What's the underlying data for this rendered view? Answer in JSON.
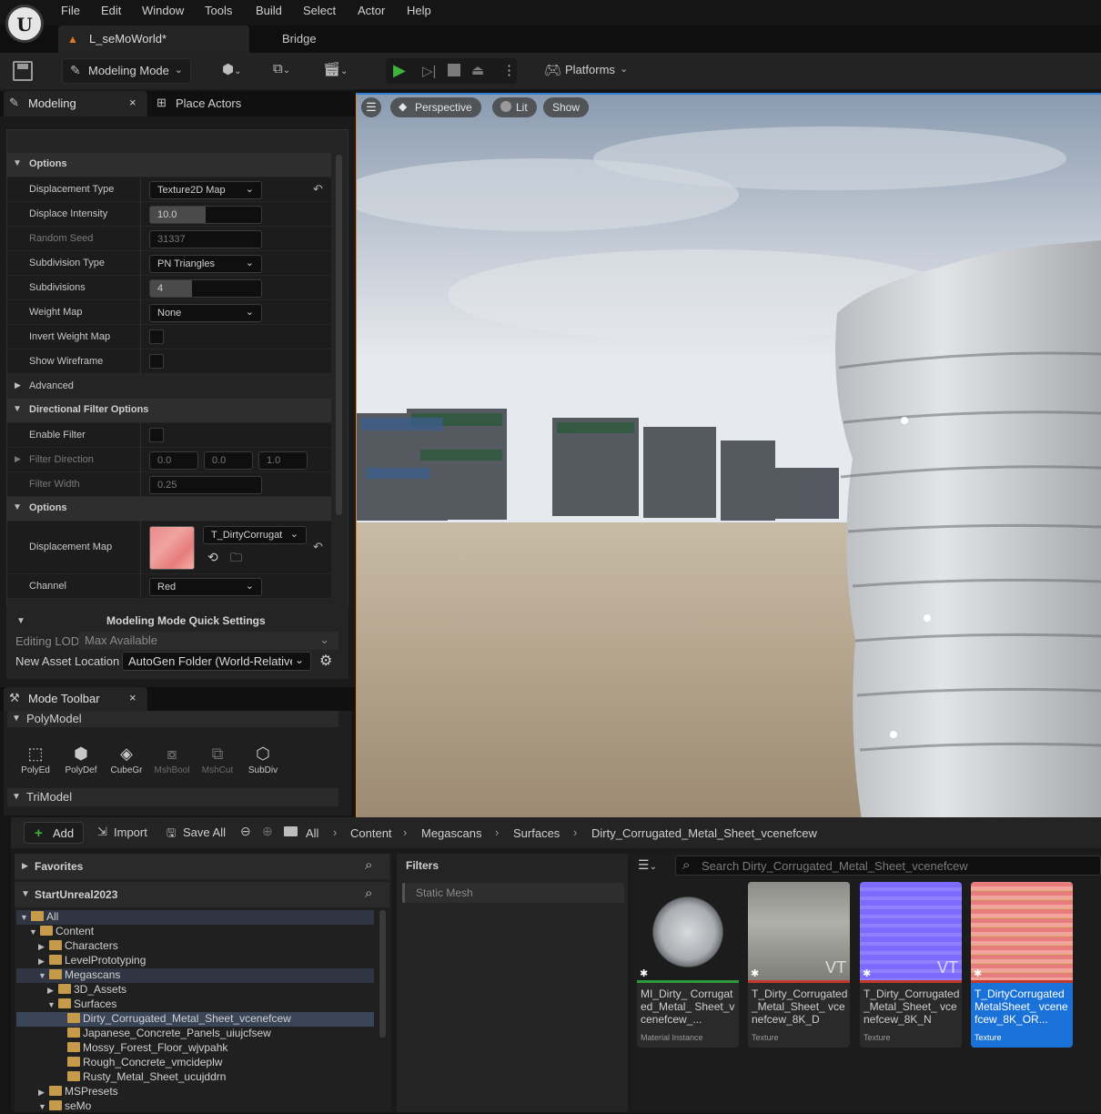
{
  "menu": [
    "File",
    "Edit",
    "Window",
    "Tools",
    "Build",
    "Select",
    "Actor",
    "Help"
  ],
  "doc_tab": "L_seMoWorld*",
  "bridge_tab": "Bridge",
  "toolbar": {
    "mode": "Modeling Mode",
    "platforms": "Platforms"
  },
  "panel_tabs": {
    "modeling": "Modeling",
    "place_actors": "Place Actors"
  },
  "details": {
    "options1": "Options",
    "displacement_type": {
      "label": "Displacement Type",
      "value": "Texture2D Map"
    },
    "displace_intensity": {
      "label": "Displace Intensity",
      "value": "10.0",
      "fill": 0.5
    },
    "random_seed": {
      "label": "Random Seed",
      "value": "31337"
    },
    "subdivision_type": {
      "label": "Subdivision Type",
      "value": "PN Triangles"
    },
    "subdivisions": {
      "label": "Subdivisions",
      "value": "4",
      "fill": 0.38
    },
    "weight_map": {
      "label": "Weight Map",
      "value": "None"
    },
    "invert_weight_map": "Invert Weight Map",
    "show_wireframe": "Show Wireframe",
    "advanced": "Advanced",
    "directional": "Directional Filter Options",
    "enable_filter": "Enable Filter",
    "filter_direction": {
      "label": "Filter Direction",
      "x": "0.0",
      "y": "0.0",
      "z": "1.0"
    },
    "filter_width": {
      "label": "Filter Width",
      "value": "0.25"
    },
    "options2": "Options",
    "displacement_map": {
      "label": "Displacement Map",
      "value": "T_DirtyCorrugat"
    },
    "channel": {
      "label": "Channel",
      "value": "Red"
    }
  },
  "quick_settings": {
    "title": "Modeling Mode Quick Settings",
    "editing_lod_label": "Editing LOD",
    "editing_lod_value": "Max Available",
    "asset_loc_label": "New Asset Location",
    "asset_loc_value": "AutoGen Folder (World-Relative"
  },
  "mode_toolbar": {
    "title": "Mode Toolbar",
    "polymodel": "PolyModel",
    "trimodel": "TriModel",
    "tools": [
      {
        "label": "PolyEd",
        "enabled": true
      },
      {
        "label": "PolyDef",
        "enabled": true
      },
      {
        "label": "CubeGr",
        "enabled": true
      },
      {
        "label": "MshBool",
        "enabled": false
      },
      {
        "label": "MshCut",
        "enabled": false
      },
      {
        "label": "SubDiv",
        "enabled": true
      }
    ]
  },
  "viewport": {
    "perspective": "Perspective",
    "lit": "Lit",
    "show": "Show"
  },
  "content_browser": {
    "add": "Add",
    "import": "Import",
    "save_all": "Save All",
    "breadcrumb": [
      "All",
      "Content",
      "Megascans",
      "Surfaces",
      "Dirty_Corrugated_Metal_Sheet_vcenefcew"
    ],
    "favorites": "Favorites",
    "project": "StartUnreal2023",
    "filters": "Filters",
    "filter_chip": "Static Mesh",
    "search_placeholder": "Search Dirty_Corrugated_Metal_Sheet_vcenefcew",
    "tree": [
      {
        "label": "All",
        "depth": 0,
        "expanded": true,
        "state": "hl"
      },
      {
        "label": "Content",
        "depth": 1,
        "expanded": true,
        "state": ""
      },
      {
        "label": "Characters",
        "depth": 2,
        "expanded": false,
        "state": ""
      },
      {
        "label": "LevelPrototyping",
        "depth": 2,
        "expanded": false,
        "state": ""
      },
      {
        "label": "Megascans",
        "depth": 2,
        "expanded": true,
        "state": "hl"
      },
      {
        "label": "3D_Assets",
        "depth": 3,
        "expanded": false,
        "state": ""
      },
      {
        "label": "Surfaces",
        "depth": 3,
        "expanded": true,
        "state": ""
      },
      {
        "label": "Dirty_Corrugated_Metal_Sheet_vcenefcew",
        "depth": 4,
        "expanded": null,
        "state": "sel"
      },
      {
        "label": "Japanese_Concrete_Panels_uiujcfsew",
        "depth": 4,
        "expanded": null,
        "state": ""
      },
      {
        "label": "Mossy_Forest_Floor_wjvpahk",
        "depth": 4,
        "expanded": null,
        "state": ""
      },
      {
        "label": "Rough_Concrete_vmcideplw",
        "depth": 4,
        "expanded": null,
        "state": ""
      },
      {
        "label": "Rusty_Metal_Sheet_ucujddrn",
        "depth": 4,
        "expanded": null,
        "state": ""
      },
      {
        "label": "MSPresets",
        "depth": 2,
        "expanded": false,
        "state": ""
      },
      {
        "label": "seMo",
        "depth": 2,
        "expanded": true,
        "state": ""
      }
    ],
    "assets": [
      {
        "name": "MI_Dirty_ Corrugated_Metal_ Sheet_vcenefcew_...",
        "type": "Material Instance",
        "bar": "#2f9a3a",
        "selected": false,
        "vt": ""
      },
      {
        "name": "T_Dirty_Corrugated _Metal_Sheet_ vcenefcew_8K_D",
        "type": "Texture",
        "bar": "#c0392b",
        "selected": false,
        "vt": "VT"
      },
      {
        "name": "T_Dirty_Corrugated _Metal_Sheet_ vcenefcew_8K_N",
        "type": "Texture",
        "bar": "#c0392b",
        "selected": false,
        "vt": "VT"
      },
      {
        "name": "T_DirtyCorrugated MetalSheet_ vcenefcew_8K_OR...",
        "type": "Texture",
        "bar": "#c0392b",
        "selected": true,
        "vt": ""
      }
    ]
  }
}
